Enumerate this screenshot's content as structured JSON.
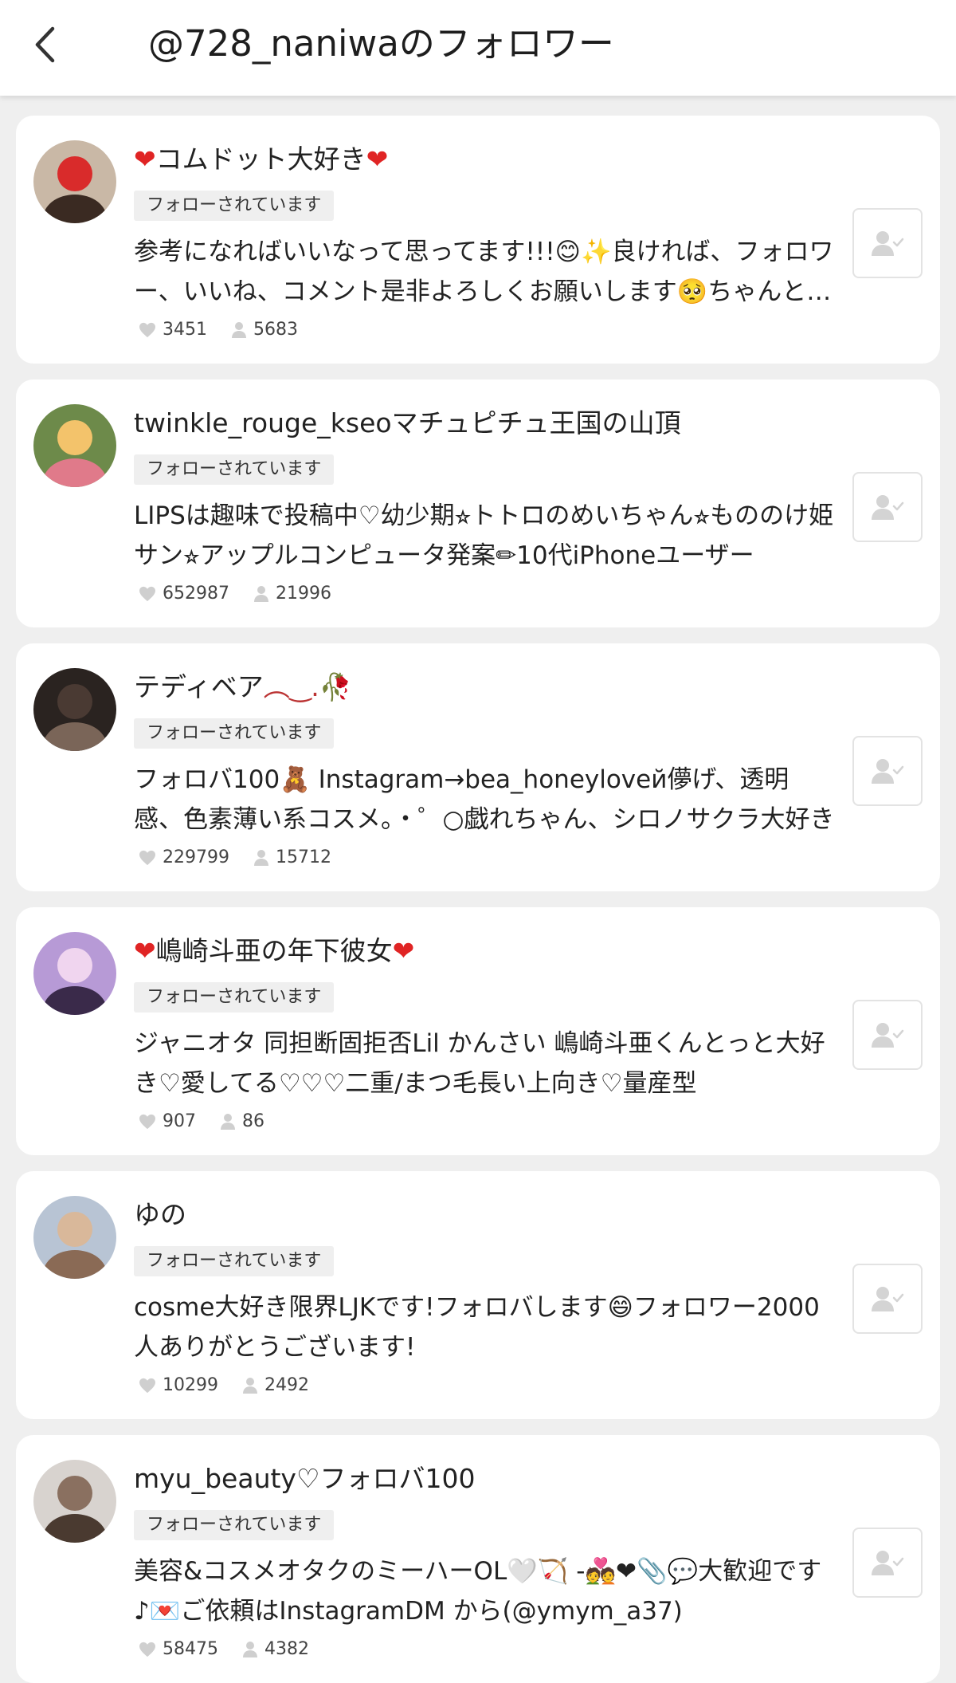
{
  "header": {
    "title": "@728_naniwaのフォロワー"
  },
  "users": [
    {
      "name_prefix": "❤",
      "name": "コムドット大好き",
      "name_suffix": "❤",
      "badge": "フォローされています",
      "bio": "参考になればいいなって思ってます!!!😊✨良ければ、フォロワー、いいね、コメント是非よろしくお願いします🥺ちゃんと返します",
      "likes": "3451",
      "followers": "5683",
      "avatar_colors": [
        "#c9b8a6",
        "#3a2a22",
        "#d92b2b"
      ]
    },
    {
      "name_prefix": "",
      "name": "twinkle_rouge_kseoマチュピチュ王国の山頂",
      "name_suffix": "",
      "badge": "フォローされています",
      "bio": "LIPSは趣味で投稿中♡幼少期⭐︎トトロのめいちゃん⭐︎もののけ姫サン⭐︎アップルコンピュータ発案✏10代iPhoneユーザー",
      "likes": "652987",
      "followers": "21996",
      "avatar_colors": [
        "#6d8a4a",
        "#e07a8a",
        "#f3c36b"
      ]
    },
    {
      "name_prefix": "",
      "name": "テディベア",
      "name_suffix": "︵‿.🥀",
      "badge": "フォローされています",
      "bio": "フォロバ100🧸 Instagram→bea_honeyloveй儚げ、透明感、色素薄い系コスメ。・゜○戯れちゃん、シロノサクラ大好き",
      "likes": "229799",
      "followers": "15712",
      "avatar_colors": [
        "#2a2320",
        "#7a6558",
        "#4a3a33"
      ]
    },
    {
      "name_prefix": "❤",
      "name": "嶋崎斗亜の年下彼女",
      "name_suffix": "❤",
      "badge": "フォローされています",
      "bio": "ジャニオタ 同担断固拒否Lil かんさい 嶋崎斗亜くんとっと大好き♡愛してる♡♡♡二重/まつ毛長い上向き♡量産型",
      "likes": "907",
      "followers": "86",
      "avatar_colors": [
        "#b79ad6",
        "#3a2a4a",
        "#f0d5ef"
      ]
    },
    {
      "name_prefix": "",
      "name": "ゆの",
      "name_suffix": "",
      "badge": "フォローされています",
      "bio": "cosme大好き限界LJKです!フォロバします😄フォロワー2000人ありがとうございます!",
      "likes": "10299",
      "followers": "2492",
      "avatar_colors": [
        "#b8c4d4",
        "#8a6a55",
        "#d9b89a"
      ]
    },
    {
      "name_prefix": "",
      "name": "myu_beauty♡フォロバ100",
      "name_suffix": "",
      "badge": "フォローされています",
      "bio": "美容&コスメオタクのミーハーOL🤍🏹 -💑❤📎💬大歓迎です♪💌ご依頼はInstagramDM から(@ymym_a37)",
      "likes": "58475",
      "followers": "4382",
      "avatar_colors": [
        "#d8d3cf",
        "#4a3a30",
        "#8a7060"
      ]
    }
  ]
}
